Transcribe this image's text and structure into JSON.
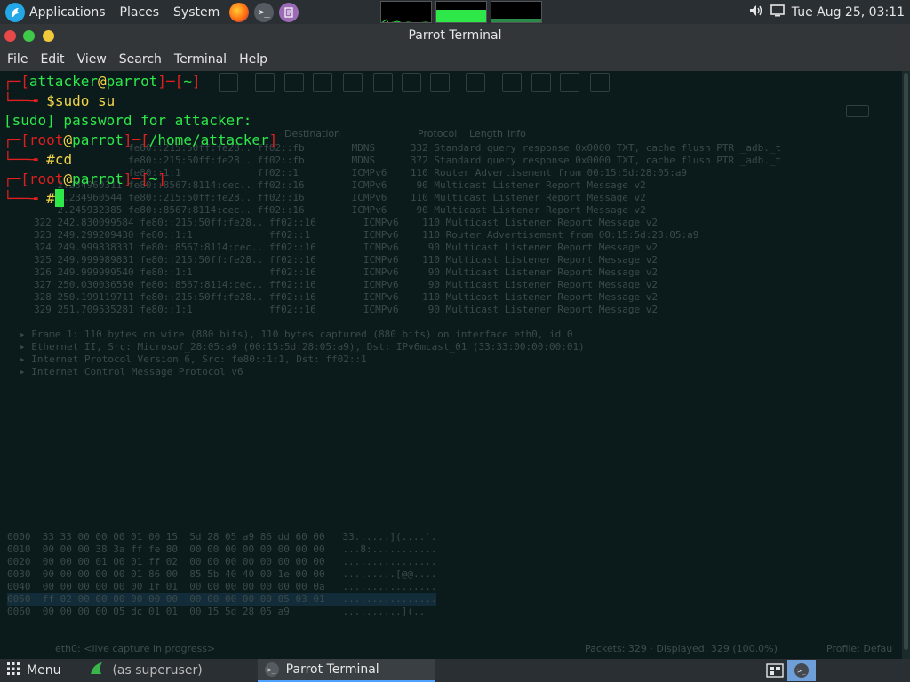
{
  "top_panel": {
    "applications": "Applications",
    "places": "Places",
    "system": "System",
    "clock": "Tue Aug 25, 03:11"
  },
  "window": {
    "title": "Parrot Terminal"
  },
  "menubar": {
    "file": "File",
    "edit": "Edit",
    "view": "View",
    "search": "Search",
    "terminal": "Terminal",
    "help": "Help"
  },
  "terminal": {
    "line1_user": "attacker",
    "line1_at": "@",
    "line1_host": "parrot",
    "line1_dir": "~",
    "line2_cmd": "sudo su",
    "line3": "[sudo] password for attacker:",
    "line4_user": "root",
    "line4_at": "@",
    "line4_host": "parrot",
    "line4_dir": "/home/attacker",
    "line5_cmd": "cd",
    "line6_user": "root",
    "line6_at": "@",
    "line6_host": "parrot",
    "line6_dir": "~"
  },
  "ghost": {
    "col_destination": "Destination",
    "col_protocol": "Protocol",
    "col_length": "Length",
    "col_info": "Info",
    "rows": [
      "                fe80::215:50ff:fe28.. ff02::fb        MDNS      332 Standard query response 0x0000 TXT, cache flush PTR _adb._t",
      "                fe80::215:50ff:fe28.. ff02::fb        MDNS      372 Standard query response 0x0000 TXT, cache flush PTR _adb._t",
      "                fe80::1:1             ff02::1         ICMPv6    110 Router Advertisement from 00:15:5d:28:05:a9",
      "    2.234960311 fe80::8567:8114:cec.. ff02::16        ICMPv6     90 Multicast Listener Report Message v2",
      "    2.234960544 fe80::215:50ff:fe28.. ff02::16        ICMPv6    110 Multicast Listener Report Message v2",
      "    2.245932385 fe80::8567:8114:cec.. ff02::16        ICMPv6     90 Multicast Listener Report Message v2",
      "322 242.830099584 fe80::215:50ff:fe28.. ff02::16        ICMPv6    110 Multicast Listener Report Message v2",
      "323 249.299209430 fe80::1:1             ff02::1         ICMPv6    110 Router Advertisement from 00:15:5d:28:05:a9",
      "324 249.999838331 fe80::8567:8114:cec.. ff02::16        ICMPv6     90 Multicast Listener Report Message v2",
      "325 249.999989831 fe80::215:50ff:fe28.. ff02::16        ICMPv6    110 Multicast Listener Report Message v2",
      "326 249.999999540 fe80::1:1             ff02::16        ICMPv6     90 Multicast Listener Report Message v2",
      "327 250.030036550 fe80::8567:8114:cec.. ff02::16        ICMPv6     90 Multicast Listener Report Message v2",
      "328 250.199119711 fe80::215:50ff:fe28.. ff02::16        ICMPv6    110 Multicast Listener Report Message v2",
      "329 251.709535281 fe80::1:1             ff02::16        ICMPv6     90 Multicast Listener Report Message v2"
    ],
    "details": [
      "▸ Frame 1: 110 bytes on wire (880 bits), 110 bytes captured (880 bits) on interface eth0, id 0",
      "▸ Ethernet II, Src: Microsof_28:05:a9 (00:15:5d:28:05:a9), Dst: IPv6mcast_01 (33:33:00:00:00:01)",
      "▸ Internet Protocol Version 6, Src: fe80::1:1, Dst: ff02::1",
      "▸ Internet Control Message Protocol v6"
    ],
    "hex": [
      "0000  33 33 00 00 00 01 00 15  5d 28 05 a9 86 dd 60 00   33......](....`.",
      "0010  00 00 00 38 3a ff fe 80  00 00 00 00 00 00 00 00   ...8:...........",
      "0020  00 00 00 01 00 01 ff 02  00 00 00 00 00 00 00 00   ................",
      "0030  00 00 00 00 00 01 86 00  85 5b 40 40 00 1e 00 00   .........[@@....",
      "0040  00 00 00 00 00 00 1f 01  00 00 00 00 00 00 00 0a   ................",
      "0050  ff 02 00 00 00 00 00 00  00 00 00 00 00 05 03 01   ................",
      "0060  00 00 00 00 05 dc 01 01  00 15 5d 28 05 a9         ..........](.."
    ],
    "status_left": "eth0: <live capture in progress>",
    "status_packets": "Packets: 329 · Displayed: 329 (100.0%)",
    "status_profile": "Profile: Defau"
  },
  "bottom_panel": {
    "menu": "Menu",
    "task1": "(as superuser)",
    "task2": "Parrot Terminal"
  },
  "colors": {
    "prompt_bracket": "#e02020",
    "prompt_text": "#2ee84a",
    "prompt_cmd": "#f0d44a",
    "terminal_bg": "#0b1a1a"
  }
}
